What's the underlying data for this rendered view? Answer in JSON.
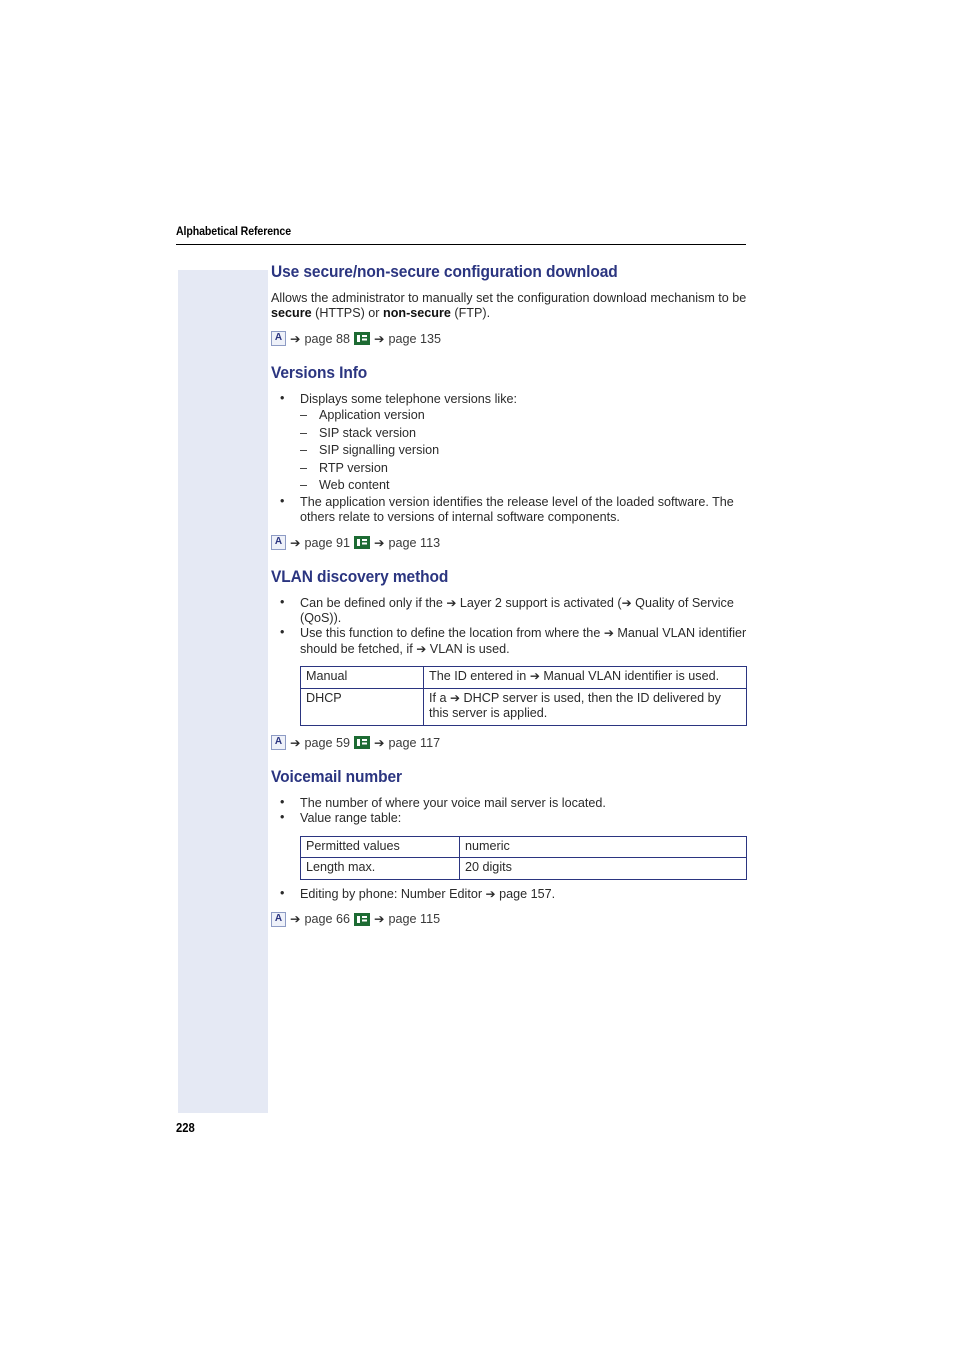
{
  "header": {
    "running_title": "Alphabetical Reference"
  },
  "folio": {
    "page_number": "228"
  },
  "colors": {
    "heading": "#2b3580",
    "side_tab": "#e5e9f4",
    "table_border": "#2b3580",
    "icon_form_green": "#1d6b33"
  },
  "icons": {
    "admin_label": "A",
    "arrow": "➔"
  },
  "sections": [
    {
      "id": "use-secure-non-secure-configuration-download",
      "title": "Use secure/non-secure configuration download",
      "paragraph": {
        "part1": "Allows the administrator to manually set the configuration download mechanism to be ",
        "bold1": "secure",
        "part2": " (HTTPS) or ",
        "bold2": "non-secure",
        "part3": " (FTP)."
      },
      "xref": {
        "admin_page": "page 88",
        "web_page": "page 135"
      }
    },
    {
      "id": "versions-info",
      "title": "Versions Info",
      "bullets": [
        "Displays some telephone versions like:",
        "The application version identifies the release level of the loaded software. The others relate to versions of internal software components."
      ],
      "sub_items": [
        "Application version",
        "SIP stack version",
        "SIP signalling version",
        "RTP version",
        "Web content"
      ],
      "xref": {
        "admin_page": "page 91",
        "web_page": "page 113"
      }
    },
    {
      "id": "vlan-discovery-method",
      "title": "VLAN discovery method",
      "bullet1": {
        "t1": "Can be defined only if the ",
        "t2": " Layer 2 support is activated (",
        "t3": " Quality of Service (QoS))."
      },
      "bullet2": {
        "t1": "Use this function to define the location from where the ",
        "t2": " Manual VLAN identifier should be fetched, if ",
        "t3": " VLAN is used."
      },
      "table": {
        "rows": [
          {
            "key": "Manual",
            "value_pre": "The ID entered in ",
            "value_post": " Manual VLAN identifier is used."
          },
          {
            "key": "DHCP",
            "value_pre": "If a ",
            "value_post": " DHCP server is used, then the ID delivered by this server is applied."
          }
        ]
      },
      "xref": {
        "admin_page": "page 59",
        "web_page": "page 117"
      }
    },
    {
      "id": "voicemail-number",
      "title": "Voicemail number",
      "bullets": [
        "The number of where your voice mail server is located.",
        "Value range table:"
      ],
      "table": {
        "rows": [
          {
            "key": "Permitted values",
            "value": "numeric"
          },
          {
            "key": "Length max.",
            "value": "20 digits"
          }
        ]
      },
      "bullet_after": {
        "pre": "Editing by phone: Number Editor ",
        "post": " page 157."
      },
      "xref": {
        "admin_page": "page 66",
        "web_page": "page 115"
      }
    }
  ]
}
